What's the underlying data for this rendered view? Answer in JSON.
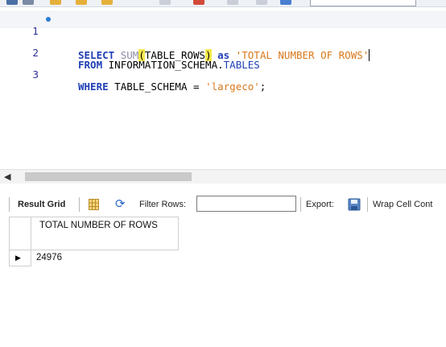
{
  "editor": {
    "lines": [
      {
        "number": "1",
        "tokens": {
          "select": "SELECT",
          "sum": "SUM",
          "paren_open": "(",
          "column": "TABLE_ROWS",
          "paren_close": ")",
          "as": "as",
          "alias": "'TOTAL NUMBER OF ROWS'"
        }
      },
      {
        "number": "2",
        "tokens": {
          "from": "FROM",
          "schema": "INFORMATION_SCHEMA",
          "dot": ".",
          "table": "TABLES"
        }
      },
      {
        "number": "3",
        "tokens": {
          "where": "WHERE",
          "column": "TABLE_SCHEMA",
          "eq": " = ",
          "value": "'largeco'",
          "semi": ";"
        }
      }
    ]
  },
  "result_toolbar": {
    "result_grid_label": "Result Grid",
    "filter_label": "Filter Rows:",
    "filter_value": "",
    "export_label": "Export:",
    "wrap_label": "Wrap Cell Cont"
  },
  "grid": {
    "columns": [
      "TOTAL NUMBER OF ROWS"
    ],
    "rows": [
      [
        "24976"
      ]
    ],
    "row_marker": "▶"
  },
  "colors": {
    "keyword": "#1f3fb4",
    "string": "#d8781a",
    "highlight": "#f6e94c"
  },
  "icons": [
    "breakpoint-dot-icon",
    "scroll-left-arrow-icon",
    "grid-view-icon",
    "refresh-icon",
    "export-save-icon",
    "current-row-arrow-icon"
  ]
}
